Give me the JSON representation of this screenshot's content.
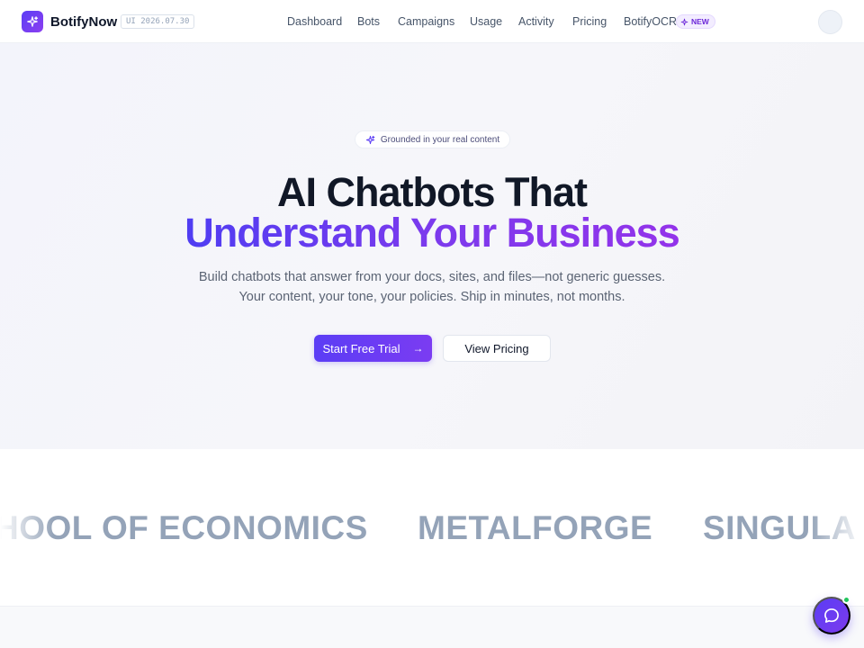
{
  "brand": {
    "name": "BotifyNow",
    "version": "UI 2026.07.30"
  },
  "nav": {
    "links": [
      "Dashboard",
      "Bots",
      "Campaigns",
      "Usage",
      "Activity",
      "Pricing",
      "BotifyOCR"
    ],
    "new_badge": "NEW"
  },
  "hero": {
    "pill": "Grounded in your real content",
    "headline_line1": "AI Chatbots That",
    "headline_line2": "Understand Your Business",
    "subtitle_line1": "Build chatbots that answer from your docs, sites, and files—not generic guesses.",
    "subtitle_line2": "Your content, your tone, your policies. Ship in minutes, not months.",
    "primary_cta": "Start Free Trial",
    "primary_cta_arrow": "→",
    "secondary_cta": "View Pricing"
  },
  "logos": [
    "HOOL OF ECONOMICS",
    "METALFORGE",
    "SINGULA"
  ],
  "icons": {
    "brand": "sparkle-icon",
    "pill": "sparkle-icon",
    "new_badge": "sparkle-icon",
    "chat": "chat-bubble-icon"
  },
  "colors": {
    "accent": "#5b3df5",
    "accent_end": "#9333ea",
    "online": "#22c55e",
    "logo_gray": "#94a3b8"
  }
}
